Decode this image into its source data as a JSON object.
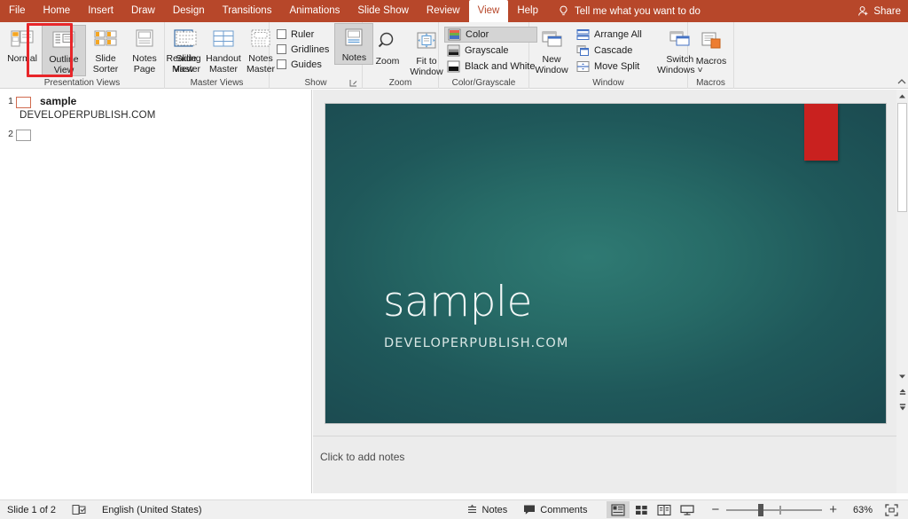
{
  "app": {
    "accent_color": "#b7472a",
    "menu_tabs": [
      {
        "label": "File",
        "active": false
      },
      {
        "label": "Home",
        "active": false
      },
      {
        "label": "Insert",
        "active": false
      },
      {
        "label": "Draw",
        "active": false
      },
      {
        "label": "Design",
        "active": false
      },
      {
        "label": "Transitions",
        "active": false
      },
      {
        "label": "Animations",
        "active": false
      },
      {
        "label": "Slide Show",
        "active": false
      },
      {
        "label": "Review",
        "active": false
      },
      {
        "label": "View",
        "active": true
      },
      {
        "label": "Help",
        "active": false
      }
    ],
    "tell_me": "Tell me what you want to do",
    "share_label": "Share"
  },
  "ribbon": {
    "presentation_views": {
      "group_label": "Presentation Views",
      "buttons": [
        {
          "label": "Normal",
          "icon": "normal-view-icon",
          "selected": false
        },
        {
          "label": "Outline\nView",
          "icon": "outline-view-icon",
          "selected": true
        },
        {
          "label": "Slide\nSorter",
          "icon": "slide-sorter-icon",
          "selected": false
        },
        {
          "label": "Notes\nPage",
          "icon": "notes-page-icon",
          "selected": false
        },
        {
          "label": "Reading\nView",
          "icon": "reading-view-icon",
          "selected": false
        }
      ],
      "highlight_color": "#e8262a"
    },
    "master_views": {
      "group_label": "Master Views",
      "buttons": [
        {
          "label": "Slide\nMaster",
          "icon": "slide-master-icon"
        },
        {
          "label": "Handout\nMaster",
          "icon": "handout-master-icon"
        },
        {
          "label": "Notes\nMaster",
          "icon": "notes-master-icon"
        }
      ]
    },
    "show": {
      "group_label": "Show",
      "checkboxes": [
        {
          "label": "Ruler",
          "checked": false
        },
        {
          "label": "Gridlines",
          "checked": false
        },
        {
          "label": "Guides",
          "checked": false
        }
      ],
      "notes_button": {
        "label": "Notes",
        "icon": "notes-icon",
        "selected": true
      }
    },
    "zoom": {
      "group_label": "Zoom",
      "buttons": [
        {
          "label": "Zoom",
          "icon": "magnifier-icon"
        },
        {
          "label": "Fit to\nWindow",
          "icon": "fit-to-window-icon"
        }
      ]
    },
    "color_grayscale": {
      "group_label": "Color/Grayscale",
      "items": [
        {
          "label": "Color",
          "icon": "color-swatch-icon",
          "selected": true
        },
        {
          "label": "Grayscale",
          "icon": "grayscale-swatch-icon",
          "selected": false
        },
        {
          "label": "Black and White",
          "icon": "blackwhite-swatch-icon",
          "selected": false
        }
      ]
    },
    "window": {
      "group_label": "Window",
      "new_window": {
        "label": "New\nWindow",
        "icon": "new-window-icon"
      },
      "items": [
        {
          "label": "Arrange All",
          "icon": "arrange-all-icon"
        },
        {
          "label": "Cascade",
          "icon": "cascade-icon"
        },
        {
          "label": "Move Split",
          "icon": "move-split-icon"
        }
      ],
      "switch_windows": {
        "label": "Switch\nWindows ˅",
        "icon": "switch-windows-icon"
      }
    },
    "macros": {
      "group_label": "Macros",
      "button": {
        "label": "Macros",
        "icon": "macros-icon"
      }
    }
  },
  "outline": {
    "slides": [
      {
        "number": "1",
        "title": "sample",
        "body": "DEVELOPERPUBLISH.COM",
        "current": true
      },
      {
        "number": "2",
        "title": "",
        "body": "",
        "current": false
      }
    ]
  },
  "slide": {
    "title": "sample",
    "subtitle": "DEVELOPERPUBLISH.COM",
    "background_color": "#27676a",
    "accent_shape_color": "#c9211f"
  },
  "notes": {
    "placeholder": "Click to add notes"
  },
  "status_bar": {
    "slide_count": "Slide 1 of 2",
    "accessibility_icon": "accessibility-checker-icon",
    "language": "English (United States)",
    "notes_label": "Notes",
    "comments_label": "Comments",
    "views": [
      {
        "name": "normal-view",
        "selected": true
      },
      {
        "name": "slide-sorter-view",
        "selected": false
      },
      {
        "name": "reading-view",
        "selected": false
      },
      {
        "name": "slide-show-view",
        "selected": false
      }
    ],
    "zoom_out": "−",
    "zoom_in": "+",
    "zoom_level": "63%",
    "fit_slide_icon": "fit-slide-to-window-icon"
  }
}
